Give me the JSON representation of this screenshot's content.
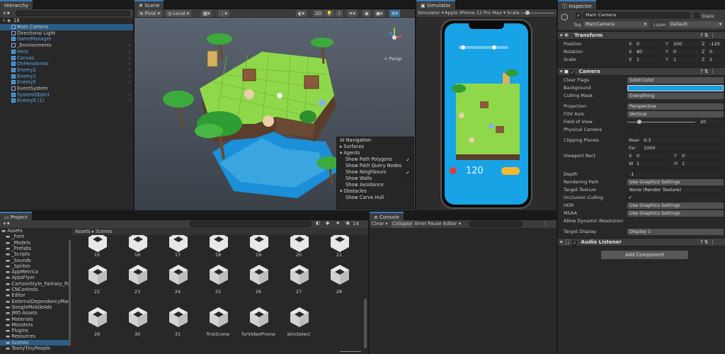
{
  "hierarchy": {
    "tab": "Hierarchy",
    "scene_name": "18",
    "items": [
      {
        "label": "Main Camera",
        "depth": 1,
        "selected": true,
        "blue": false,
        "arrow": false
      },
      {
        "label": "Directional Light",
        "depth": 1,
        "selected": false,
        "blue": false,
        "arrow": false
      },
      {
        "label": "GameManager",
        "depth": 1,
        "selected": false,
        "blue": true,
        "arrow": false
      },
      {
        "label": "_Environments",
        "depth": 1,
        "selected": false,
        "blue": false,
        "arrow": true
      },
      {
        "label": "Hero",
        "depth": 1,
        "selected": false,
        "blue": true,
        "arrow": true
      },
      {
        "label": "Canvas",
        "depth": 1,
        "selected": false,
        "blue": true,
        "arrow": true
      },
      {
        "label": "OnHeroArrow",
        "depth": 1,
        "selected": false,
        "blue": true,
        "arrow": true
      },
      {
        "label": "Enemy2",
        "depth": 1,
        "selected": false,
        "blue": true,
        "arrow": true
      },
      {
        "label": "Enemy1",
        "depth": 1,
        "selected": false,
        "blue": true,
        "arrow": true
      },
      {
        "label": "Enemy5",
        "depth": 1,
        "selected": false,
        "blue": true,
        "arrow": true
      },
      {
        "label": "EventSystem",
        "depth": 1,
        "selected": false,
        "blue": false,
        "arrow": false
      },
      {
        "label": "SystemObject",
        "depth": 1,
        "selected": false,
        "blue": true,
        "arrow": true
      },
      {
        "label": "Enemy5 (1)",
        "depth": 1,
        "selected": false,
        "blue": true,
        "arrow": true
      }
    ]
  },
  "scene": {
    "tab": "Scene",
    "pivot": "Pivot",
    "local": "Local",
    "mode_2d": "2D",
    "persp": "< Persp",
    "overlay": {
      "title": "AI Navigation",
      "surfaces": "Surfaces",
      "agents": "Agents",
      "items": [
        {
          "label": "Show Path Polygons",
          "checked": true
        },
        {
          "label": "Show Path Query Nodes",
          "checked": false
        },
        {
          "label": "Show Neighbours",
          "checked": true
        },
        {
          "label": "Show Walls",
          "checked": false
        },
        {
          "label": "Show Avoidance",
          "checked": false
        }
      ],
      "obstacles": "Obstacles",
      "obstacle_items": [
        {
          "label": "Show Carve Hull",
          "checked": false
        }
      ]
    }
  },
  "simulator": {
    "tab": "Simulator",
    "mode": "Simulator",
    "device": "Apple iPhone 12 Pro Max",
    "scale": "Scale",
    "score": "120"
  },
  "project": {
    "tab": "Project",
    "count": "14",
    "breadcrumb": [
      "Assets",
      "Scenes"
    ],
    "tree": [
      {
        "label": "Assets",
        "depth": 0
      },
      {
        "label": "_Font",
        "depth": 1
      },
      {
        "label": "_Models",
        "depth": 1
      },
      {
        "label": "_Prefabs",
        "depth": 1
      },
      {
        "label": "_Scripts",
        "depth": 1
      },
      {
        "label": "_Sounds",
        "depth": 1
      },
      {
        "label": "_Sprites",
        "depth": 1
      },
      {
        "label": "AppMetrica",
        "depth": 1
      },
      {
        "label": "AppsFlyer",
        "depth": 1
      },
      {
        "label": "CartoonStyle_Fantasy_Pa",
        "depth": 1
      },
      {
        "label": "CNControls",
        "depth": 1
      },
      {
        "label": "Editor",
        "depth": 1
      },
      {
        "label": "ExternalDependencyMana",
        "depth": 1
      },
      {
        "label": "GoogleMobileAds",
        "depth": 1
      },
      {
        "label": "JMO Assets",
        "depth": 1
      },
      {
        "label": "Materials",
        "depth": 1
      },
      {
        "label": "Monsters",
        "depth": 1
      },
      {
        "label": "Plugins",
        "depth": 1
      },
      {
        "label": "Resources",
        "depth": 1
      },
      {
        "label": "Scenes",
        "depth": 1
      },
      {
        "label": "ToonyTinyPeople",
        "depth": 1
      }
    ],
    "top_labels": [
      "15",
      "16",
      "17",
      "18",
      "19",
      "20",
      "21"
    ],
    "rows": [
      [
        "22",
        "23",
        "24",
        "25",
        "26",
        "27",
        "28"
      ],
      [
        "29",
        "30",
        "31",
        "firstScene",
        "forVideoPromo",
        "skinSelect"
      ]
    ]
  },
  "console": {
    "tab": "Console",
    "clear": "Clear",
    "collapse": "Collapse",
    "error_pause": "Error Pause",
    "editor": "Editor"
  },
  "inspector": {
    "tab": "Inspector",
    "object_name": "Main Camera",
    "static": "Static",
    "tag_label": "Tag",
    "tag_value": "MainCamera",
    "layer_label": "Layer",
    "layer_value": "Default",
    "transform": {
      "title": "Transform",
      "rows": [
        {
          "label": "Position",
          "x": "0",
          "y": "200",
          "z": "-120"
        },
        {
          "label": "Rotation",
          "x": "80",
          "y": "0",
          "z": "0"
        },
        {
          "label": "Scale",
          "x": "1",
          "y": "1",
          "z": "1"
        }
      ]
    },
    "camera": {
      "title": "Camera",
      "clear_flags": {
        "label": "Clear Flags",
        "value": "Solid Color"
      },
      "background": {
        "label": "Background",
        "color": "#1aa0e0"
      },
      "culling_mask": {
        "label": "Culling Mask",
        "value": "Everything"
      },
      "projection": {
        "label": "Projection",
        "value": "Perspective"
      },
      "fov_axis": {
        "label": "FOV Axis",
        "value": "Vertical"
      },
      "field_of_view": {
        "label": "Field of View",
        "value": "20"
      },
      "physical_camera": {
        "label": "Physical Camera"
      },
      "clipping_planes": {
        "label": "Clipping Planes",
        "near_label": "Near",
        "near": "0.3",
        "far_label": "Far",
        "far": "1000"
      },
      "viewport_rect": {
        "label": "Viewport Rect",
        "x": "0",
        "y": "0",
        "w": "1",
        "h": "1"
      },
      "depth": {
        "label": "Depth",
        "value": "-1"
      },
      "rendering_path": {
        "label": "Rendering Path",
        "value": "Use Graphics Settings"
      },
      "target_texture": {
        "label": "Target Texture",
        "value": "None (Render Texture)"
      },
      "occlusion_culling": {
        "label": "Occlusion Culling"
      },
      "hdr": {
        "label": "HDR",
        "value": "Use Graphics Settings"
      },
      "msaa": {
        "label": "MSAA",
        "value": "Use Graphics Settings"
      },
      "allow_dynamic_resolution": {
        "label": "Allow Dynamic Resolution"
      },
      "target_display": {
        "label": "Target Display",
        "value": "Display 1"
      }
    },
    "audio_listener": "Audio Listener",
    "add_component": "Add Component"
  }
}
